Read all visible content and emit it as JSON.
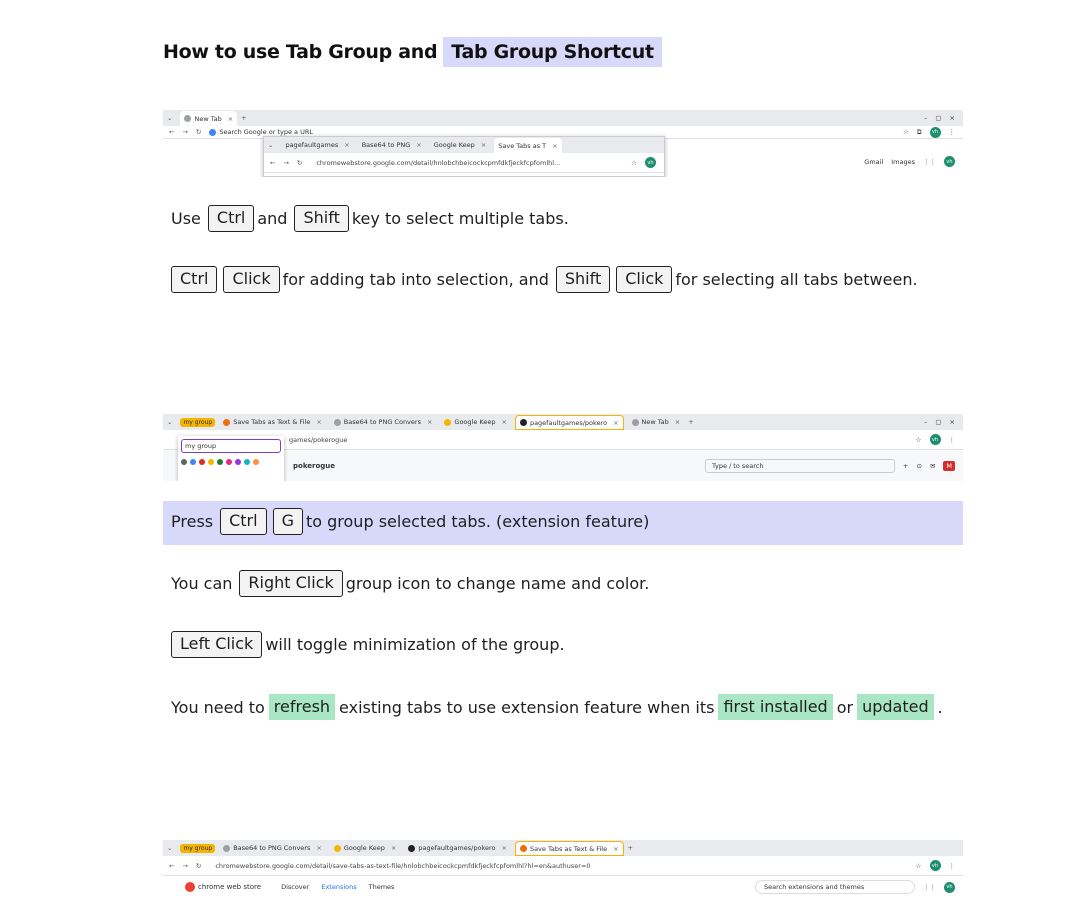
{
  "title": {
    "text": "How to use Tab Group and",
    "highlight": "Tab Group Shortcut"
  },
  "shot1": {
    "tab": "New Tab",
    "search_text": "Search Google or type a URL",
    "popup_tabs": [
      "pagefaultgames",
      "Base64 to PNG",
      "Google Keep",
      "Save Tabs as T"
    ],
    "popup_url": "chromewebstore.google.com/detail/hnlobchbeicockcpmfdkfjeckfcpfomlhl...",
    "links": [
      "Gmail",
      "Images"
    ],
    "avatar": "vh"
  },
  "para1": {
    "use": "Use",
    "ctrl": "Ctrl",
    "and": "and",
    "shift": "Shift",
    "rest": "key to select multiple tabs."
  },
  "para2": {
    "ctrl": "Ctrl",
    "click1": "Click",
    "mid": "for adding tab into selection, and",
    "shift": "Shift",
    "click2": "Click",
    "rest": "for selecting all tabs between."
  },
  "shot2": {
    "group_name": "my group",
    "tabs": [
      "Save Tabs as Text & File",
      "Base64 to PNG Convers",
      "Google Keep",
      "pagefaultgames/pokero",
      "New Tab"
    ],
    "url": "games/pokerogue",
    "input_value": "my group",
    "colors": [
      "#5f6368",
      "#4285f4",
      "#d93025",
      "#f4b400",
      "#188038",
      "#e52592",
      "#9334e6",
      "#12b5cb",
      "#fa903e"
    ],
    "repo": "pokerogue",
    "search_placeholder": "Type / to search",
    "avatar": "vh"
  },
  "para3": {
    "press": "Press",
    "ctrl": "Ctrl",
    "g": "G",
    "rest": "to group selected tabs. (extension feature)"
  },
  "para4": {
    "you_can": "You can",
    "right_click": "Right Click",
    "rest": "group icon to change name and color."
  },
  "para5": {
    "left_click": "Left Click",
    "rest": "will toggle minimization of the group."
  },
  "para6": {
    "start": "You need to",
    "refresh": "refresh",
    "mid": "existing tabs to use extension feature when its",
    "first_installed": "first installed",
    "or": "or",
    "updated": "updated",
    "end": "."
  },
  "shot3": {
    "group_name": "my group",
    "tabs": [
      "Base64 to PNG Convers",
      "Google Keep",
      "pagefaultgames/pokero",
      "Save Tabs as Text & File"
    ],
    "url": "chromewebstore.google.com/detail/save-tabs-as-text-file/hnlobchbeicockcpmfdkfjeckfcpfomlhl?hl=en&authuser=0",
    "store": "chrome web store",
    "nav": [
      "Discover",
      "Extensions",
      "Themes"
    ],
    "search_placeholder": "Search extensions and themes",
    "avatar": "vh"
  }
}
